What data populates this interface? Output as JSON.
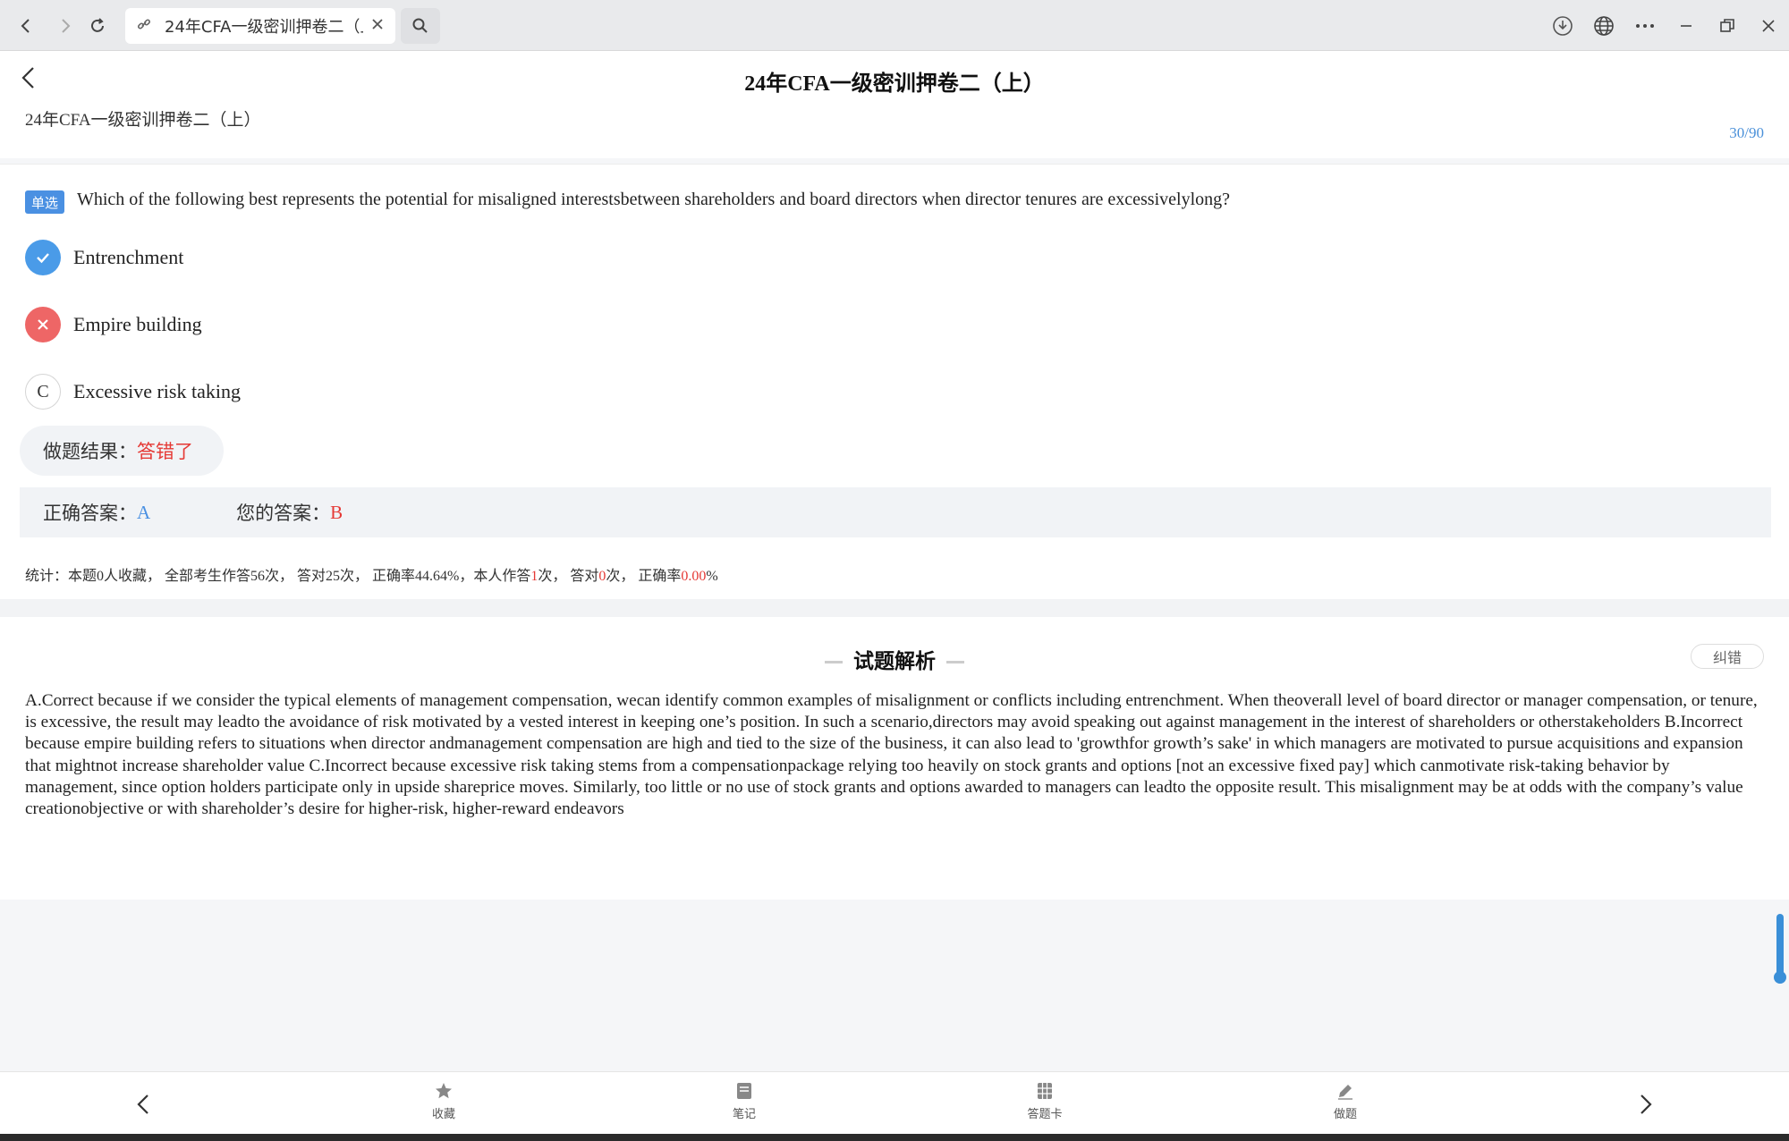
{
  "browser": {
    "tab_title": "24年CFA一级密训押卷二（上）",
    "icons": [
      "back-icon",
      "forward-icon",
      "reload-icon",
      "link-icon",
      "close-icon",
      "search-icon",
      "download-icon",
      "globe-icon",
      "more-icon",
      "minimize-icon",
      "restore-icon",
      "window-close-icon"
    ]
  },
  "header": {
    "title": "24年CFA一级密训押卷二（上）",
    "exam_name": "24年CFA一级密训押卷二（上）",
    "progress": "30/90"
  },
  "question": {
    "type_badge": "单选",
    "text": "Which of the following best represents the potential for misaligned interestsbetween shareholders and board directors when director tenures are excessivelylong?",
    "options": [
      {
        "letter": "A",
        "text": "Entrenchment",
        "state": "correct"
      },
      {
        "letter": "B",
        "text": "Empire building",
        "state": "wrong"
      },
      {
        "letter": "C",
        "text": "Excessive risk taking",
        "state": "none"
      }
    ]
  },
  "result": {
    "label": "做题结果：",
    "value": "答错了"
  },
  "answers": {
    "correct_label": "正确答案：",
    "correct_value": "A",
    "user_label": "您的答案：",
    "user_value": "B"
  },
  "stats": {
    "p1": "统计：本题0人收藏， 全部考生作答56次， 答对25次， 正确率44.64%，本人作答",
    "self_attempts": "1",
    "p2": "次， 答对",
    "self_correct": "0",
    "p3": "次， 正确率",
    "self_rate": "0.00",
    "p4": "%"
  },
  "analysis": {
    "title": "试题解析",
    "report_label": "纠错",
    "text": "A.Correct because if we consider the typical elements of management compensation, wecan identify common examples of misalignment or conflicts including entrenchment. When theoverall level of board director or manager compensation, or tenure, is excessive, the result may leadto the avoidance of risk motivated by a vested interest in keeping one’s position. In such a scenario,directors may avoid speaking out against management in the interest of shareholders or otherstakeholders B.Incorrect because empire building refers to situations when director andmanagement compensation are high and tied to the size of the business, it can also lead to 'growthfor growth’s sake' in which managers are motivated to pursue acquisitions and expansion that mightnot increase shareholder value C.Incorrect because excessive risk taking stems from a compensationpackage relying too heavily on stock grants and options [not an excessive fixed pay] which canmotivate risk-taking behavior by management, since option holders participate only in upside shareprice moves. Similarly, too little or no use of stock grants and options awarded to managers can leadto the opposite result. This misalignment may be at odds with the company’s value creationobjective or with shareholder’s desire for higher-risk, higher-reward endeavors"
  },
  "bottom_bar": {
    "favorite": "收藏",
    "notes": "笔记",
    "answer_card": "答题卡",
    "practice": "做题"
  },
  "colors": {
    "accent": "#4a90e2",
    "error": "#e53935"
  }
}
